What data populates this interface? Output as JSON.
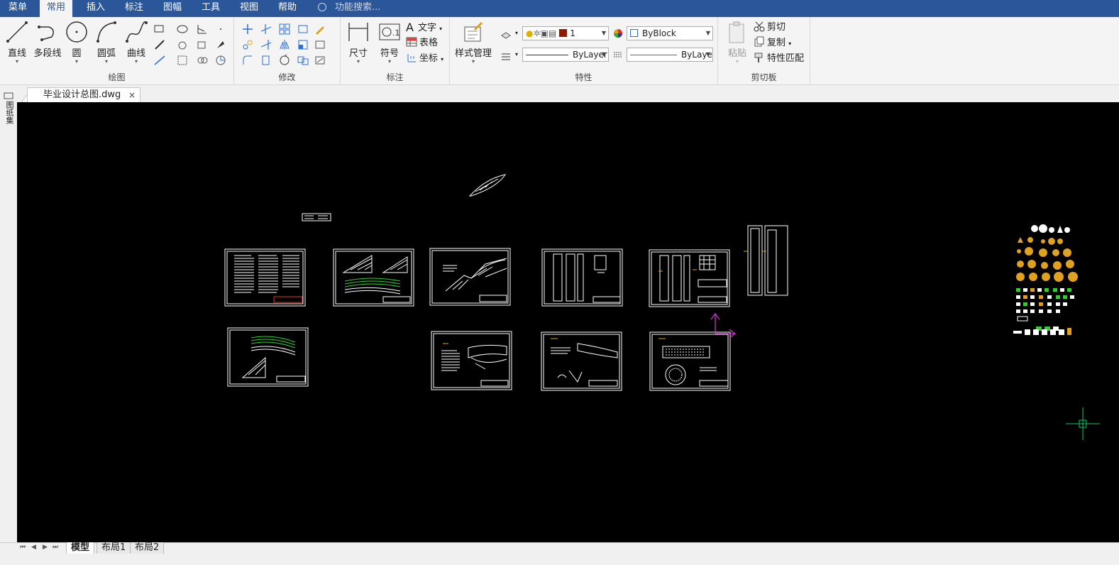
{
  "menubar": {
    "items": [
      "菜单",
      "常用",
      "插入",
      "标注",
      "图幅",
      "工具",
      "视图",
      "帮助"
    ],
    "active": "常用",
    "search_label": "功能搜索..."
  },
  "ribbon": {
    "draw": {
      "title": "绘图",
      "line": "直线",
      "polyline": "多段线",
      "circle": "圆",
      "arc": "圆弧",
      "curve": "曲线"
    },
    "modify": {
      "title": "修改"
    },
    "annotate": {
      "title": "标注",
      "dimension": "尺寸",
      "symbol": "符号",
      "text": "文字",
      "table": "表格",
      "coordinate": "坐标"
    },
    "properties": {
      "title": "特性",
      "style_manager": "样式管理",
      "layer_value": "1",
      "color_value": "ByBlock",
      "linetype_value": "ByLayer",
      "lineweight_value": "ByLayer"
    },
    "clipboard": {
      "title": "剪切板",
      "paste": "粘贴",
      "cut": "剪切",
      "copy": "复制",
      "match_properties": "特性匹配"
    }
  },
  "document": {
    "tab_title": "毕业设计总图.dwg",
    "close_glyph": "×"
  },
  "left_strip": {
    "text": "图纸集"
  },
  "layout_tabs": [
    "模型",
    "布局1",
    "布局2"
  ],
  "layout_active": "模型",
  "nav_glyphs": [
    "⏮",
    "◀",
    "▶",
    "⏭"
  ],
  "colors": {
    "menubar": "#2b579a",
    "canvas": "#000000",
    "drawing_lines": "#ffffff",
    "ucs_icon": "#cc33cc",
    "crosshair": "#00cc66",
    "layer_color_swatch": "#8b1a00",
    "linetype_red": "#e03030"
  }
}
